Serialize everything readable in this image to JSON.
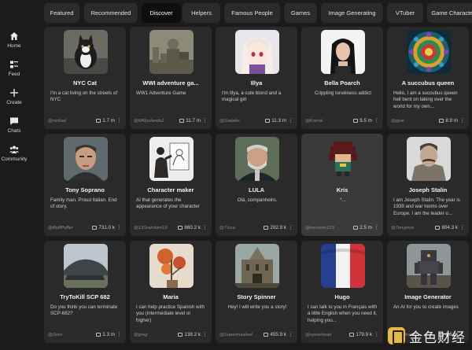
{
  "sidebar": {
    "items": [
      {
        "label": "Home",
        "icon": "home-icon"
      },
      {
        "label": "Feed",
        "icon": "feed-icon"
      },
      {
        "label": "Create",
        "icon": "plus-icon"
      },
      {
        "label": "Chats",
        "icon": "chat-icon"
      },
      {
        "label": "Community",
        "icon": "people-icon"
      }
    ]
  },
  "tabs": {
    "items": [
      "Featured",
      "Recommended",
      "Discover",
      "Helpers",
      "Famous People",
      "Games",
      "Image Generating",
      "VTuber",
      "Game Characters"
    ],
    "active": "Discover"
  },
  "characters": [
    {
      "name": "NYC Cat",
      "desc": "I'm a cat living on the streets of NYC",
      "author": "@sinbad",
      "count": "1.7 m"
    },
    {
      "name": "WWI adventure ga...",
      "desc": "WW1 Adventure Game",
      "author": "@MRpolands2",
      "count": "11.7 m"
    },
    {
      "name": "Illya",
      "desc": "I'm Illya, a cute blond and a magical girl",
      "author": "@Sadako",
      "count": "11.3 m"
    },
    {
      "name": "Bella Poarch",
      "desc": "Crippling loneliness addict",
      "author": "@Kamal",
      "count": "9.5 m"
    },
    {
      "name": "A succubus queen",
      "desc": "Hello, I am a succubus queen hell bent on taking over the world for my own...",
      "author": "@gjoe",
      "count": "8.9 m"
    },
    {
      "name": "Tony Soprano",
      "desc": "Family man. Proud Italian. End of story.",
      "author": "@BuffPuffer",
      "count": "731.0 k"
    },
    {
      "name": "Character maker",
      "desc": "AI that generates the appearance of your character",
      "author": "@13Srandom13",
      "count": "660.2 k"
    },
    {
      "name": "LULA",
      "desc": "Olá, companheiro.",
      "author": "@Tisza",
      "count": "292.9 k"
    },
    {
      "name": "Kris",
      "desc": "*...",
      "author": "@mustwin123",
      "count": "2.5 m"
    },
    {
      "name": "Joseph Stalin",
      "desc": "I am Joseph Stalin. The year is 1939 and war looms over Europe. I am the leader o...",
      "author": "@Tonyprox",
      "count": "804.3 k"
    },
    {
      "name": "TryToKill SCP 682",
      "desc": "Do you think you can terminate SCP-682?",
      "author": "@Swix",
      "count": "1.3 m"
    },
    {
      "name": "Maria",
      "desc": "I can help practice Spanish with you (intermediate level or higher)",
      "author": "@greg",
      "count": "138.2 k"
    },
    {
      "name": "Story Spinner",
      "desc": "Hey! I will write you a story!",
      "author": "@Supermasked",
      "count": "455.9 k"
    },
    {
      "name": "Hugo",
      "desc": "I can talk to you in Français with a little English when you need it, helping you...",
      "author": "@xpearhead",
      "count": "179.9 k"
    },
    {
      "name": "Image Generator",
      "desc": "An AI for you to create images",
      "author": "@Nikhilreddi",
      "count": "1.5 m"
    }
  ],
  "watermark": {
    "text": "金色财经"
  },
  "colors": {
    "background": "#1b1b1b",
    "card": "#2a2a2a",
    "card_highlight": "#3a3a3a",
    "tab": "#2b2b2b",
    "tab_active": "#0e0e0e"
  }
}
